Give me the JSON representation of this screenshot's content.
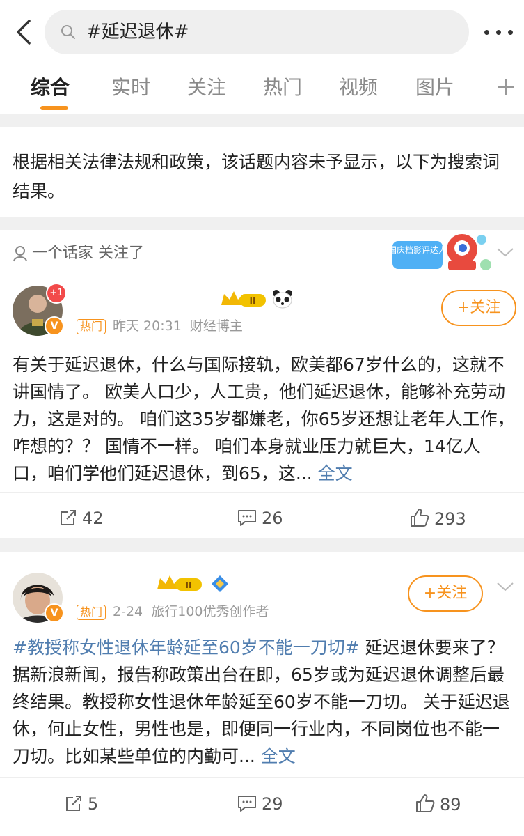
{
  "search": {
    "query": "#延迟退休#"
  },
  "tabs": [
    {
      "label": "综合"
    },
    {
      "label": "实时"
    },
    {
      "label": "关注"
    },
    {
      "label": "热门"
    },
    {
      "label": "视频"
    },
    {
      "label": "图片"
    }
  ],
  "notice": "根据相关法律法规和政策，该话题内容未予显示，以下为搜索词结果。",
  "posts": [
    {
      "source": "一个话家 关注了",
      "hot_label": "热门",
      "time": "昨天 20:31",
      "author_desc": "财经博主",
      "plus_badge": "+1",
      "level_badge": "II",
      "follow_label": "+关注",
      "text": "有关于延迟退休，什么与国际接轨，欧美都67岁什么的，这就不讲国情了。 欧美人口少，人工贵，他们延迟退休，能够补充劳动力，这是对的。 咱们这35岁都嫌老，你65岁还想让老年人工作，咋想的？？ 国情不一样。 咱们本身就业压力就巨大，14亿人口，咱们学他们延迟退休，到65，这...",
      "full_label": "全文",
      "reposts": "42",
      "comments": "26",
      "likes": "293"
    },
    {
      "hot_label": "热门",
      "time": "2-24",
      "author_desc": "旅行100优秀创作者",
      "level_badge": "II",
      "follow_label": "+关注",
      "topic": "#教授称女性退休年龄延至60岁不能一刀切#",
      "text": " 延迟退休要来了？据新浪新闻，报告称政策出台在即，65岁或为延迟退休调整后最终结果。教授称女性退休年龄延至60岁不能一刀切。 关于延迟退休，何止女性，男性也是，即便同一行业内，不同岗位也不能一刀切。比如某些单位的内勤可...",
      "full_label": "全文",
      "reposts": "5",
      "comments": "29",
      "likes": "89"
    }
  ],
  "promo_text": "国庆档影评达人",
  "colors": {
    "accent": "#f7931e",
    "link": "#507daf",
    "badge_red": "#f24a4a"
  }
}
